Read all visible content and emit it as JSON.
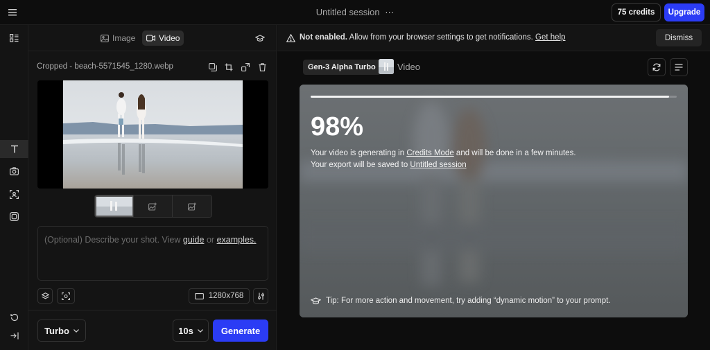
{
  "header": {
    "session_title": "Untitled session",
    "more_glyph": "···",
    "credits_label": "75 credits",
    "upgrade_label": "Upgrade"
  },
  "rail": {
    "items": [
      "sessions-icon",
      "text-icon",
      "camera-icon",
      "scan-face-icon",
      "layers-icon",
      "history-icon",
      "collapse-icon"
    ]
  },
  "left_panel": {
    "tabs": [
      {
        "label": "Image",
        "icon": "image-icon",
        "active": false
      },
      {
        "label": "Video",
        "icon": "video-icon",
        "active": true
      }
    ],
    "file_name": "Cropped - beach-5571545_1280.webp",
    "prompt": {
      "placeholder_prefix": "(Optional) Describe your shot. View",
      "guide_label": "guide",
      "or_label": "or",
      "examples_label": "examples."
    },
    "resolution": "1280x768",
    "model_select": "Turbo",
    "duration_select": "10s",
    "generate_label": "Generate"
  },
  "notification": {
    "bold_text": "Not enabled.",
    "text": "Allow from your browser settings to get notifications.",
    "help_label": "Get help",
    "dismiss_label": "Dismiss"
  },
  "output": {
    "model_badge": "Gen-3 Alpha Turbo",
    "media_type": "Video",
    "progress_percent": 98,
    "progress_label": "98%",
    "line1_prefix": "Your video is generating in",
    "line1_link": "Credits Mode",
    "line1_suffix": "and will be done in a few minutes.",
    "line2_prefix": "Your export will be saved to",
    "line2_link": "Untitled session",
    "tip": "Tip: For more action and movement, try adding “dynamic motion” to your prompt."
  },
  "colors": {
    "accent": "#2b3cf5",
    "background": "#0d0d0d",
    "panel": "#141414"
  }
}
